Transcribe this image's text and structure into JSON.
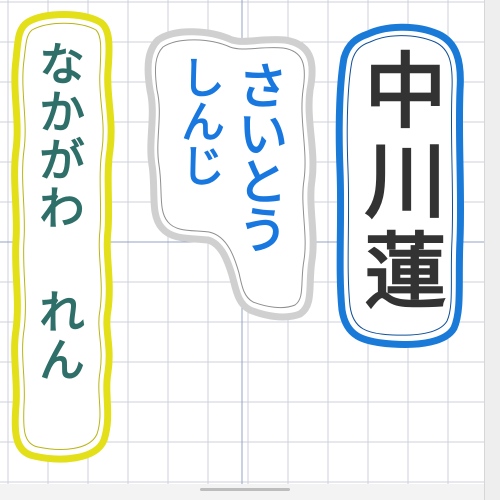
{
  "colors": {
    "background": "#ffffff",
    "grid": "#ccd1db",
    "grid_center": "#93a3c4",
    "scrollbar": "#d9d9d9",
    "bottom_bar": "#e6e6e6"
  },
  "patches": [
    {
      "name": "nakagawa-ren-patch",
      "text": "なかがわ れん",
      "text_color": "#2f6f69",
      "border_color": "#e3e01a",
      "border_type": "yellow-satin",
      "kind": "hiragana"
    },
    {
      "name": "saito-shinji-patch",
      "text_column_1": "さいとう",
      "text_column_2": "しんじ",
      "text_color": "#1878e0",
      "border_color": "#d0d0d0",
      "kind": "hiragana"
    },
    {
      "name": "nakagawa-ren-kanji-patch",
      "text": "中川蓮",
      "text_color": "#333333",
      "border_color": "#1a7ad8",
      "kind": "kanji"
    }
  ]
}
